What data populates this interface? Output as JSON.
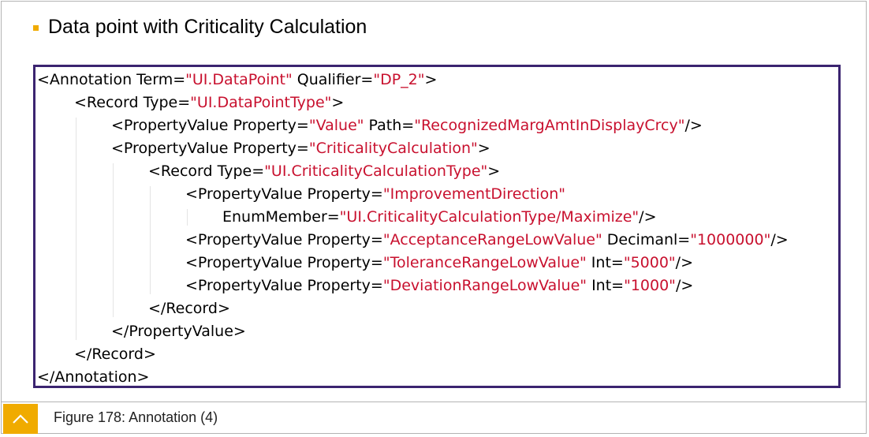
{
  "heading": "Data point with Criticality Calculation",
  "code": {
    "lines": [
      {
        "indent": 0,
        "parts": [
          {
            "t": "<Annotation Term=",
            "s": false
          },
          {
            "t": "\"UI.DataPoint\"",
            "s": true
          },
          {
            "t": " Qualifier=",
            "s": false
          },
          {
            "t": "\"DP_2\"",
            "s": true
          },
          {
            "t": ">",
            "s": false
          }
        ]
      },
      {
        "indent": 1,
        "parts": [
          {
            "t": "<Record Type=",
            "s": false
          },
          {
            "t": "\"UI.DataPointType\"",
            "s": true
          },
          {
            "t": ">",
            "s": false
          }
        ]
      },
      {
        "indent": 2,
        "parts": [
          {
            "t": "<PropertyValue Property=",
            "s": false
          },
          {
            "t": "\"Value\"",
            "s": true
          },
          {
            "t": " Path=",
            "s": false
          },
          {
            "t": "\"RecognizedMargAmtInDisplayCrcy\"",
            "s": true
          },
          {
            "t": "/>",
            "s": false
          }
        ]
      },
      {
        "indent": 2,
        "parts": [
          {
            "t": "<PropertyValue Property=",
            "s": false
          },
          {
            "t": "\"CriticalityCalculation\"",
            "s": true
          },
          {
            "t": ">",
            "s": false
          }
        ]
      },
      {
        "indent": 3,
        "parts": [
          {
            "t": "<Record Type=",
            "s": false
          },
          {
            "t": "\"UI.CriticalityCalculationType\"",
            "s": true
          },
          {
            "t": ">",
            "s": false
          }
        ]
      },
      {
        "indent": 4,
        "parts": [
          {
            "t": "<PropertyValue Property=",
            "s": false
          },
          {
            "t": "\"ImprovementDirection\"",
            "s": true
          }
        ]
      },
      {
        "indent": 5,
        "parts": [
          {
            "t": "EnumMember=",
            "s": false
          },
          {
            "t": "\"UI.CriticalityCalculationType/Maximize\"",
            "s": true
          },
          {
            "t": "/>",
            "s": false
          }
        ]
      },
      {
        "indent": 4,
        "parts": [
          {
            "t": "<PropertyValue Property=",
            "s": false
          },
          {
            "t": "\"AcceptanceRangeLowValue\"",
            "s": true
          },
          {
            "t": " Decimanl=",
            "s": false
          },
          {
            "t": "\"1000000\"",
            "s": true
          },
          {
            "t": "/>",
            "s": false
          }
        ]
      },
      {
        "indent": 4,
        "parts": [
          {
            "t": "<PropertyValue Property=",
            "s": false
          },
          {
            "t": "\"ToleranceRangeLowValue\"",
            "s": true
          },
          {
            "t": " Int=",
            "s": false
          },
          {
            "t": "\"5000\"",
            "s": true
          },
          {
            "t": "/>",
            "s": false
          }
        ]
      },
      {
        "indent": 4,
        "parts": [
          {
            "t": "<PropertyValue Property=",
            "s": false
          },
          {
            "t": "\"DeviationRangeLowValue\"",
            "s": true
          },
          {
            "t": " Int=",
            "s": false
          },
          {
            "t": "\"1000\"",
            "s": true
          },
          {
            "t": "/>",
            "s": false
          }
        ]
      },
      {
        "indent": 3,
        "parts": [
          {
            "t": "</Record>",
            "s": false
          }
        ]
      },
      {
        "indent": 2,
        "parts": [
          {
            "t": "</PropertyValue>",
            "s": false
          }
        ]
      },
      {
        "indent": 1,
        "parts": [
          {
            "t": "</Record>",
            "s": false
          }
        ]
      },
      {
        "indent": 0,
        "parts": [
          {
            "t": "</Annotation>",
            "s": false
          }
        ]
      }
    ]
  },
  "footer": {
    "caption": "Figure 178: Annotation (4)",
    "icon": "caret-up-icon"
  },
  "colors": {
    "accent": "#f0ab00",
    "code_border": "#3b2470",
    "string": "#c8102e"
  }
}
